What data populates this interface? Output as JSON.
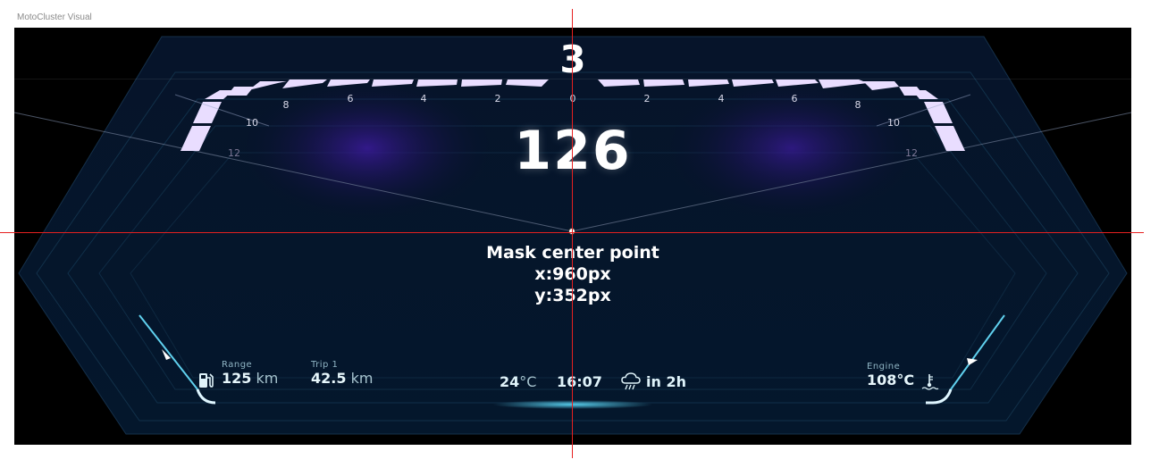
{
  "frame": {
    "title": "MotoCluster Visual"
  },
  "cluster": {
    "gear": "3",
    "speed": "126",
    "rpm_ticks_left": [
      "12",
      "10",
      "8",
      "6",
      "4",
      "2"
    ],
    "rpm_tick_center": "0",
    "rpm_ticks_right": [
      "2",
      "4",
      "6",
      "8",
      "10",
      "12"
    ],
    "mask_caption": {
      "line1": "Mask center point",
      "line2": "x:960px",
      "line3": "y:352px"
    },
    "range": {
      "label": "Range",
      "value": "125",
      "unit": "km"
    },
    "trip": {
      "label": "Trip 1",
      "value": "42.5",
      "unit": "km"
    },
    "temperature": {
      "value": "24",
      "unit": "°C"
    },
    "time": "16:07",
    "weather": {
      "text": "in 2h"
    },
    "engine": {
      "label": "Engine",
      "value": "108°C"
    },
    "fuel_level": 0.7,
    "engine_temp_level": 0.75
  },
  "icons": {
    "fuel": "fuel-pump-icon",
    "weather": "rain-cloud-icon",
    "coolant": "coolant-temperature-icon"
  },
  "colors": {
    "rpm_segment": "#e9ddff",
    "accent_cyan": "#5fd0ee",
    "guide_line": "#e62020",
    "panel_bg": "#051528"
  }
}
